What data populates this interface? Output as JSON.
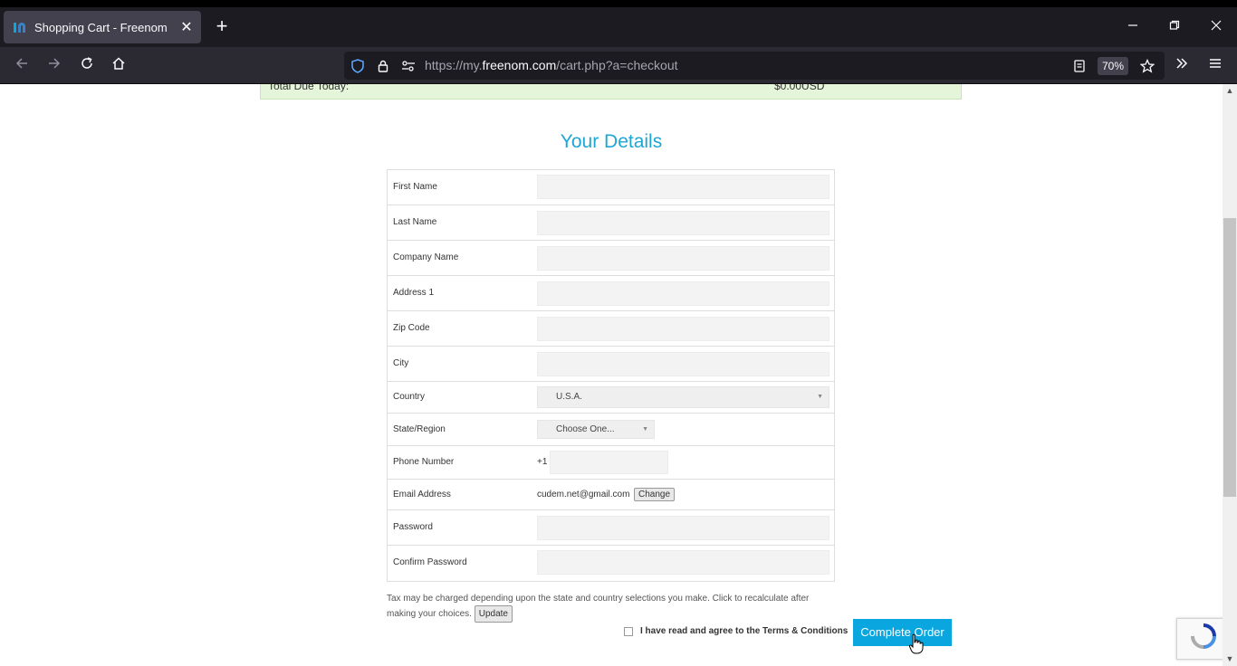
{
  "browser": {
    "tab_title": "Shopping Cart - Freenom",
    "tab_close": "✕",
    "new_tab": "+",
    "url_prefix": "https://my.",
    "url_domain": "freenom.com",
    "url_path": "/cart.php?a=checkout",
    "zoom": "70%"
  },
  "page": {
    "total_label": "Total Due Today:",
    "total_amount": "$0.00USD",
    "section_title": "Your Details",
    "fields": {
      "first_name": "First Name",
      "last_name": "Last Name",
      "company_name": "Company Name",
      "address1": "Address 1",
      "zip": "Zip Code",
      "city": "City",
      "country": "Country",
      "country_value": "U.S.A.",
      "state": "State/Region",
      "state_value": "Choose One...",
      "phone": "Phone Number",
      "phone_prefix": "+1",
      "email": "Email Address",
      "email_value": "cudem.net@gmail.com",
      "change_btn": "Change",
      "password": "Password",
      "confirm_password": "Confirm Password"
    },
    "tax_note": "Tax may be charged depending upon the state and country selections you make. Click to recalculate after making your choices.",
    "update_btn": "Update",
    "agree_text": "I have read and agree to the Terms & Conditions",
    "complete_btn": "Complete Order"
  },
  "colors": {
    "accent": "#0aa6e0",
    "title": "#1ea6d6",
    "total_bg": "#e5f5d9"
  },
  "icons": {
    "back": "arrow-left-icon",
    "forward": "arrow-right-icon",
    "reload": "reload-icon",
    "home": "home-icon",
    "shield": "shield-icon",
    "lock": "lock-icon",
    "permissions": "permissions-icon",
    "reader": "reader-view-icon",
    "bookmark": "star-icon",
    "overflow": "chevrons-right-icon",
    "menu": "hamburger-menu-icon"
  }
}
